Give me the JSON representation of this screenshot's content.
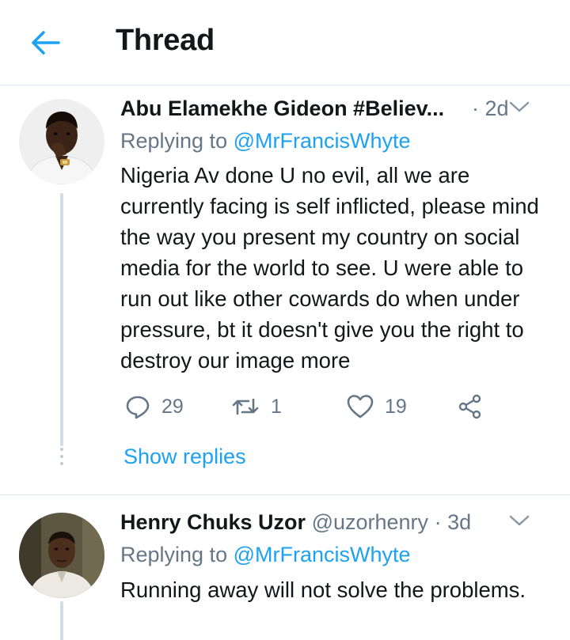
{
  "header": {
    "title": "Thread",
    "back_icon": "back-arrow-icon",
    "accent_color": "#1da1f2"
  },
  "tweets": [
    {
      "display_name": "Abu Elamekhe Gideon #Believ...",
      "handle": "",
      "time": "· 2d",
      "reply_prefix": "Replying to",
      "reply_to": "@MrFrancisWhyte",
      "text": "Nigeria Av done U no evil, all we are currently facing is self inflicted, please mind the way you present my country on social media for the world to see. U were able to run out like other cowards do when under pressure, bt it doesn't give you the right to destroy our image more",
      "reply_count": "29",
      "retweet_count": "1",
      "like_count": "19",
      "show_replies": "Show replies"
    },
    {
      "display_name": "Henry Chuks Uzor",
      "handle": "@uzorhenry",
      "time": "· 3d",
      "reply_prefix": "Replying to",
      "reply_to": "@MrFrancisWhyte",
      "text": "Running away will not solve the problems."
    }
  ],
  "colors": {
    "text_primary": "#14171a",
    "text_secondary": "#657786",
    "link": "#1da1f2",
    "divider": "#e1e8ed"
  }
}
